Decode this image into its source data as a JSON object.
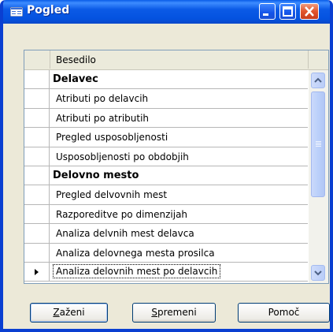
{
  "window": {
    "title": "Pogled"
  },
  "grid": {
    "column_header": "Besedilo",
    "rows": [
      {
        "text": "Delavec",
        "group": true
      },
      {
        "text": "Atributi po delavcih"
      },
      {
        "text": "Atributi po atributih"
      },
      {
        "text": "Pregled usposobljenosti"
      },
      {
        "text": "Usposobljenosti po obdobjih"
      },
      {
        "text": "Delovno mesto",
        "group": true
      },
      {
        "text": "Pregled delvovnih mest"
      },
      {
        "text": "Razporeditve po dimenzijah"
      },
      {
        "text": "Analiza delvnih mest delavca"
      },
      {
        "text": "Analiza delovnega mesta prosilca"
      },
      {
        "text": "Analiza delovnih mest po delavcih",
        "current": true
      }
    ]
  },
  "buttons": {
    "run": {
      "accel": "Z",
      "rest": "aženi"
    },
    "change": {
      "accel": "S",
      "rest": "premeni"
    },
    "help": {
      "label": "Pomoč"
    }
  },
  "colors": {
    "titlebar": "#0a5ce8",
    "frame": "#0a3fd1",
    "dialog_bg": "#ece9d8"
  },
  "icons": [
    "app-icon",
    "minimize-icon",
    "maximize-icon",
    "close-icon",
    "scroll-up-icon",
    "scroll-down-icon",
    "row-pointer-icon"
  ]
}
